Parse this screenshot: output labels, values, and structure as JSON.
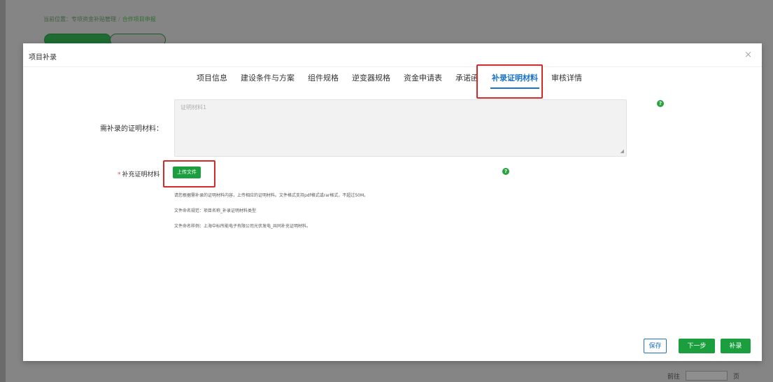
{
  "background": {
    "breadcrumb": {
      "prefix": "当前位置：",
      "parent": "专项资金补贴管理",
      "current": "合作项目申报"
    },
    "pager": {
      "goto_label": "前往",
      "page_label": "页"
    }
  },
  "modal": {
    "title": "项目补录",
    "close_icon": "×",
    "tabs": [
      {
        "label": "项目信息",
        "active": false
      },
      {
        "label": "建设条件与方案",
        "active": false
      },
      {
        "label": "组件规格",
        "active": false
      },
      {
        "label": "逆变器规格",
        "active": false
      },
      {
        "label": "资金申请表",
        "active": false
      },
      {
        "label": "承诺函",
        "active": false
      },
      {
        "label": "补录证明材料",
        "active": true
      },
      {
        "label": "审核详情",
        "active": false
      }
    ],
    "form": {
      "required_materials_label": "需补录的证明材料：",
      "required_materials_placeholder": "证明材料1",
      "supplement_label": "补充证明材料",
      "required_mark": "*",
      "upload_button": "上传文件",
      "notes": [
        "请您根据需补录的证明材料内容，上传相应的证明材料。文件格式支持pdf格式或rar格式，不超过50M。",
        "文件命名规范：项目名称_补录证明材料类型",
        "文件命名样例：上海中标所能电子有限公司光伏发电_共同补充证明材料。"
      ]
    },
    "footer": {
      "save": "保存",
      "next": "下一步",
      "submit": "补录"
    }
  },
  "colors": {
    "accent_green": "#1b9e3e",
    "tab_blue": "#1a73c8",
    "highlight_red": "#d42a2a"
  }
}
